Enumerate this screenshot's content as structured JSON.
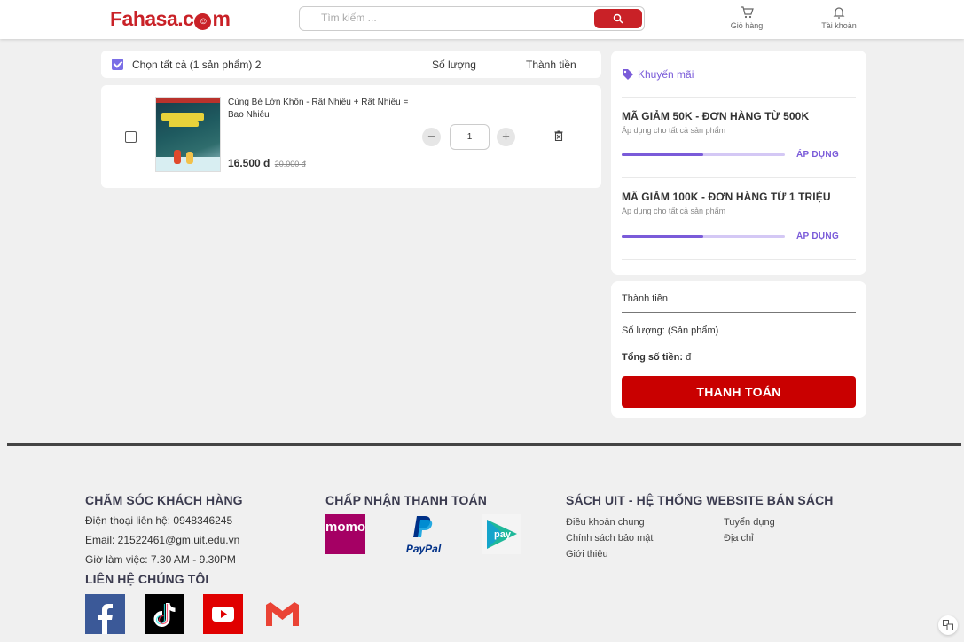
{
  "header": {
    "logo_text": "Fahasa.c",
    "logo_o": "☺",
    "logo_tail": "m",
    "search_placeholder": "Tìm kiếm ...",
    "cart_label": "Giỏ hàng",
    "account_label": "Tài khoản"
  },
  "cart": {
    "select_all_label": "Chọn tất cả (1 sản phẩm) 2",
    "col_quantity": "Số lượng",
    "col_total": "Thành tiền",
    "items": [
      {
        "name": "Cùng Bé Lớn Khôn - Rất Nhiều + Rất Nhiều = Bao Nhiêu",
        "price": "16.500 đ",
        "old_price": "20.000 đ",
        "quantity": "1"
      }
    ]
  },
  "promo": {
    "title": "Khuyến mãi",
    "coupons": [
      {
        "name": "MÃ GIẢM 50K - ĐƠN HÀNG TỪ 500K",
        "desc": "Áp dụng cho tất cả sản phẩm",
        "action": "ÁP DỤNG",
        "progress": 0.5
      },
      {
        "name": "MÃ GIẢM 100K - ĐƠN HÀNG TỪ 1 TRIỆU",
        "desc": "Áp dụng cho tất cả sản phẩm",
        "action": "ÁP DỤNG",
        "progress": 0.5
      }
    ]
  },
  "summary": {
    "subtotal_label": "Thành tiền",
    "quantity_label": "Số lượng: (Sản phẩm)",
    "total_label": "Tổng số tiền:",
    "total_value": "đ",
    "pay_button": "THANH TOÁN"
  },
  "footer": {
    "care": {
      "title": "CHĂM SÓC KHÁCH HÀNG",
      "phone": "Điện thoại liên hệ: 0948346245",
      "email": "Email: 21522461@gm.uit.edu.vn",
      "hours": "Giờ làm việc: 7.30 AM - 9.30PM"
    },
    "contact_title": "LIÊN HỆ CHÚNG TÔI",
    "payment_title": "CHẤP NHẬN THANH TOÁN",
    "payment_methods": [
      "momo",
      "PayPal",
      "pay"
    ],
    "site": {
      "title": "SÁCH UIT - HỆ THỐNG WEBSITE BÁN SÁCH",
      "links_col1": [
        "Điều khoản chung",
        "Chính sách bảo mật",
        "Giới thiệu"
      ],
      "links_col2": [
        "Tuyển dụng",
        "Địa chỉ"
      ]
    }
  },
  "colors": {
    "brand_red": "#c92127",
    "pay_red": "#c90000",
    "accent_purple": "#7a5bd9"
  }
}
